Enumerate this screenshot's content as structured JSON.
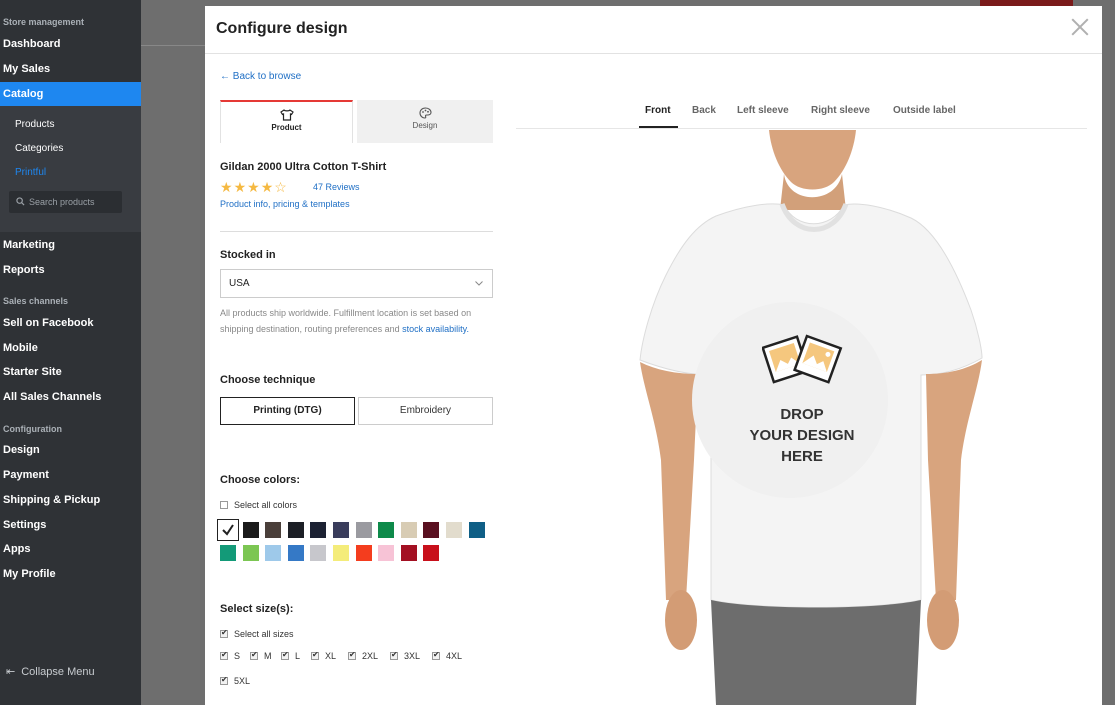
{
  "sidebar": {
    "sections": {
      "store_management": "Store management",
      "sales_channels": "Sales channels",
      "configuration": "Configuration"
    },
    "items": {
      "dashboard": "Dashboard",
      "my_sales": "My Sales",
      "catalog": "Catalog",
      "marketing": "Marketing",
      "reports": "Reports",
      "sell_on_facebook": "Sell on Facebook",
      "mobile": "Mobile",
      "starter_site": "Starter Site",
      "all_sales_channels": "All Sales Channels",
      "design": "Design",
      "payment": "Payment",
      "shipping_pickup": "Shipping & Pickup",
      "settings": "Settings",
      "apps": "Apps",
      "my_profile": "My Profile"
    },
    "catalog_sub": {
      "products": "Products",
      "categories": "Categories",
      "printful": "Printful",
      "search_placeholder": "Search products"
    },
    "collapse_label": "Collapse Menu"
  },
  "modal": {
    "title": "Configure design",
    "back_link": "Back to browse",
    "tabs": {
      "product": "Product",
      "design": "Design"
    },
    "product_name": "Gildan 2000 Ultra Cotton T-Shirt",
    "rating": 4,
    "reviews": "47 Reviews",
    "product_info_link": "Product info, pricing & templates",
    "stocked_in_label": "Stocked in",
    "stocked_in_value": "USA",
    "note_text": "All products ship worldwide. Fulfillment location is set based on shipping destination, routing preferences and",
    "note_link": "stock availability.",
    "technique_label": "Choose technique",
    "technique_dtg": "Printing (DTG)",
    "technique_embroidery": "Embroidery",
    "colors_label": "Choose colors:",
    "select_all_colors": "Select all colors",
    "colors_row1": [
      "#ffffff",
      "#1a1a1a",
      "#4a3f3a",
      "#1c1f26",
      "#1c2233",
      "#3a3d5c",
      "#9a9aa0",
      "#0e8a4a",
      "#d8ccb4",
      "#5a1020",
      "#e2dccd",
      "#0f5f86"
    ],
    "colors_row2": [
      "#139a78",
      "#7cc653",
      "#9ec9ea",
      "#3579c6",
      "#c7c7cc",
      "#f4ec7a",
      "#f43d1e",
      "#f7c3d6",
      "#a31022",
      "#c8101b"
    ],
    "sizes_label": "Select size(s):",
    "select_all_sizes": "Select all sizes",
    "sizes": [
      "S",
      "M",
      "L",
      "XL",
      "2XL",
      "3XL",
      "4XL",
      "5XL"
    ]
  },
  "preview": {
    "tabs": [
      "Front",
      "Back",
      "Left sleeve",
      "Right sleeve",
      "Outside label"
    ],
    "drop_text_1": "DROP",
    "drop_text_2": "YOUR DESIGN",
    "drop_text_3": "HERE"
  }
}
